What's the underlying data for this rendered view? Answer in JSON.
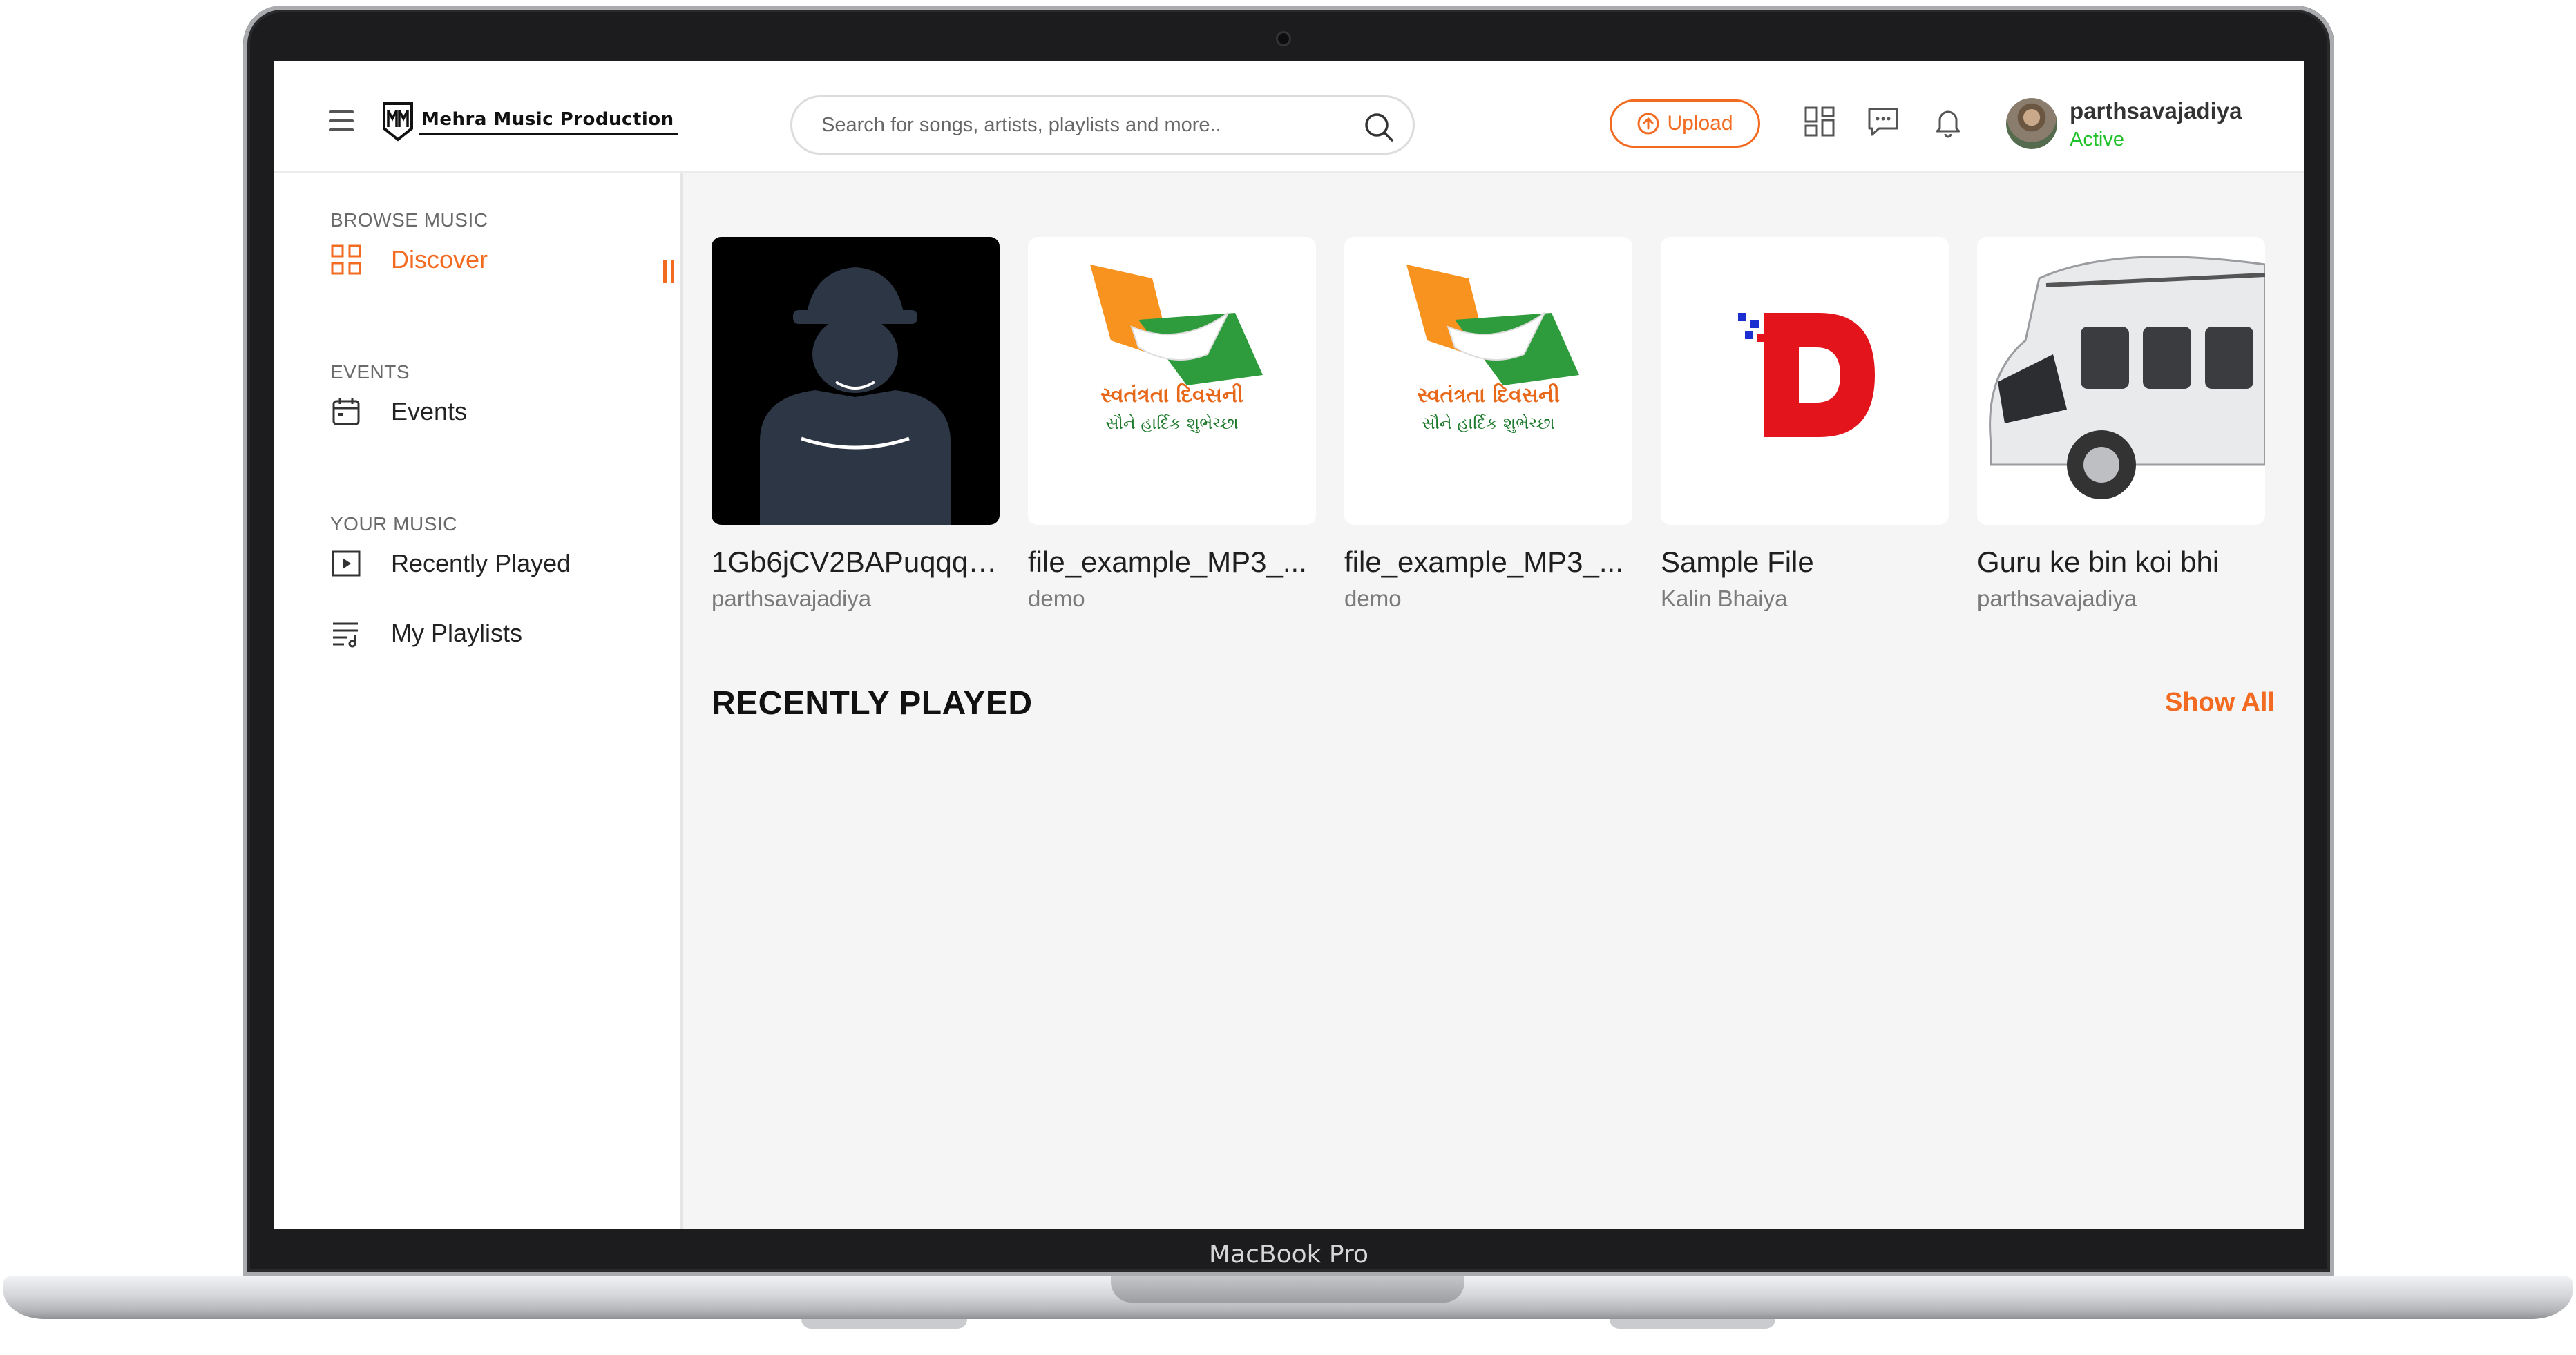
{
  "device": {
    "label": "MacBook Pro"
  },
  "header": {
    "brand": "Mehra Music Production",
    "search_placeholder": "Search for songs, artists, playlists and more..",
    "upload_label": "Upload",
    "user": {
      "name": "parthsavajadiya",
      "status": "Active"
    }
  },
  "sidebar": {
    "sections": [
      {
        "title": "BROWSE MUSIC",
        "items": [
          {
            "label": "Discover",
            "icon": "grid-icon",
            "active": true
          }
        ]
      },
      {
        "title": "EVENTS",
        "items": [
          {
            "label": "Events",
            "icon": "calendar-icon"
          }
        ]
      },
      {
        "title": "YOUR MUSIC",
        "items": [
          {
            "label": "Recently Played",
            "icon": "play-square-icon"
          },
          {
            "label": "My Playlists",
            "icon": "playlist-icon"
          }
        ]
      }
    ]
  },
  "main": {
    "cards": [
      {
        "title": "1Gb6jCV2BAPuqqqs...",
        "subtitle": "parthsavajadiya"
      },
      {
        "title": "file_example_MP3_...",
        "subtitle": "demo",
        "art_text": [
          "સ્વતંત્રતા દિવસની",
          "સૌને હાર્દિક શુભેચ્છા"
        ]
      },
      {
        "title": "file_example_MP3_...",
        "subtitle": "demo",
        "art_text": [
          "સ્વતંત્રતા દિવસની",
          "સૌને હાર્દિક શુભેચ્છા"
        ]
      },
      {
        "title": "Sample File",
        "subtitle": "Kalin Bhaiya"
      },
      {
        "title": "Guru ke bin koi bhi",
        "subtitle": "parthsavajadiya"
      }
    ],
    "recently_played": {
      "heading": "RECENTLY PLAYED",
      "show_all": "Show All"
    }
  },
  "colors": {
    "accent": "#f26b21",
    "active_status": "#21c12a"
  }
}
